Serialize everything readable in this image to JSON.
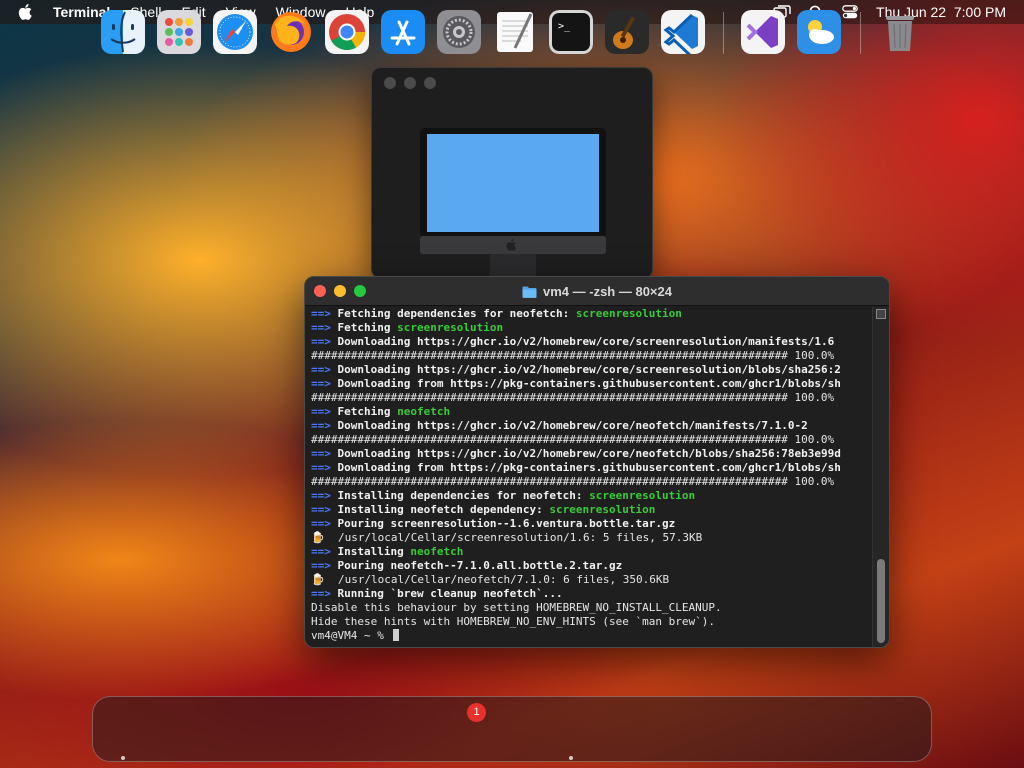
{
  "menubar": {
    "app_name": "Terminal",
    "menus": [
      "Shell",
      "Edit",
      "View",
      "Window",
      "Help"
    ],
    "clock": "Thu Jun 22  7:00 PM"
  },
  "terminal": {
    "title": "vm4 — -zsh — 80×24",
    "lines": [
      {
        "prefix": "==>",
        "parts": [
          {
            "t": " Fetching dependencies for neofetch: ",
            "s": "b"
          },
          {
            "t": "screenresolution",
            "s": "g"
          }
        ]
      },
      {
        "prefix": "==>",
        "parts": [
          {
            "t": " Fetching ",
            "s": "b"
          },
          {
            "t": "screenresolution",
            "s": "g"
          }
        ]
      },
      {
        "prefix": "==>",
        "parts": [
          {
            "t": " Downloading https://ghcr.io/v2/homebrew/core/screenresolution/manifests/1.6",
            "s": "b"
          }
        ]
      },
      {
        "prefix": "",
        "parts": [
          {
            "t": "######################################################################## 100.0%",
            "s": ""
          }
        ]
      },
      {
        "prefix": "==>",
        "parts": [
          {
            "t": " Downloading https://ghcr.io/v2/homebrew/core/screenresolution/blobs/sha256:2",
            "s": "b"
          }
        ]
      },
      {
        "prefix": "==>",
        "parts": [
          {
            "t": " Downloading from https://pkg-containers.githubusercontent.com/ghcr1/blobs/sh",
            "s": "b"
          }
        ]
      },
      {
        "prefix": "",
        "parts": [
          {
            "t": "######################################################################## 100.0%",
            "s": ""
          }
        ]
      },
      {
        "prefix": "==>",
        "parts": [
          {
            "t": " Fetching ",
            "s": "b"
          },
          {
            "t": "neofetch",
            "s": "g"
          }
        ]
      },
      {
        "prefix": "==>",
        "parts": [
          {
            "t": " Downloading https://ghcr.io/v2/homebrew/core/neofetch/manifests/7.1.0-2",
            "s": "b"
          }
        ]
      },
      {
        "prefix": "",
        "parts": [
          {
            "t": "######################################################################## 100.0%",
            "s": ""
          }
        ]
      },
      {
        "prefix": "==>",
        "parts": [
          {
            "t": " Downloading https://ghcr.io/v2/homebrew/core/neofetch/blobs/sha256:78eb3e99d",
            "s": "b"
          }
        ]
      },
      {
        "prefix": "==>",
        "parts": [
          {
            "t": " Downloading from https://pkg-containers.githubusercontent.com/ghcr1/blobs/sh",
            "s": "b"
          }
        ]
      },
      {
        "prefix": "",
        "parts": [
          {
            "t": "######################################################################## 100.0%",
            "s": ""
          }
        ]
      },
      {
        "prefix": "==>",
        "parts": [
          {
            "t": " Installing dependencies for neofetch: ",
            "s": "b"
          },
          {
            "t": "screenresolution",
            "s": "g"
          }
        ]
      },
      {
        "prefix": "==>",
        "parts": [
          {
            "t": " Installing neofetch dependency: ",
            "s": "b"
          },
          {
            "t": "screenresolution",
            "s": "g"
          }
        ]
      },
      {
        "prefix": "==>",
        "parts": [
          {
            "t": " Pouring screenresolution--1.6.ventura.bottle.tar.gz",
            "s": "b"
          }
        ]
      },
      {
        "prefix": "🍺",
        "parts": [
          {
            "t": "  /usr/local/Cellar/screenresolution/1.6: 5 files, 57.3KB",
            "s": ""
          }
        ]
      },
      {
        "prefix": "==>",
        "parts": [
          {
            "t": " Installing ",
            "s": "b"
          },
          {
            "t": "neofetch",
            "s": "g"
          }
        ]
      },
      {
        "prefix": "==>",
        "parts": [
          {
            "t": " Pouring neofetch--7.1.0.all.bottle.2.tar.gz",
            "s": "b"
          }
        ]
      },
      {
        "prefix": "🍺",
        "parts": [
          {
            "t": "  /usr/local/Cellar/neofetch/7.1.0: 6 files, 350.6KB",
            "s": ""
          }
        ]
      },
      {
        "prefix": "==>",
        "parts": [
          {
            "t": " Running `brew cleanup neofetch`...",
            "s": "b"
          }
        ]
      },
      {
        "prefix": "",
        "parts": [
          {
            "t": "Disable this behaviour by setting HOMEBREW_NO_INSTALL_CLEANUP.",
            "s": ""
          }
        ]
      },
      {
        "prefix": "",
        "parts": [
          {
            "t": "Hide these hints with HOMEBREW_NO_ENV_HINTS (see `man brew`).",
            "s": ""
          }
        ]
      }
    ],
    "prompt": "vm4@VM4 ~ % "
  },
  "dock": {
    "items": [
      "Finder",
      "Launchpad",
      "Safari",
      "Firefox",
      "Google Chrome",
      "App Store",
      "System Settings",
      "TextEdit",
      "Terminal",
      "GarageBand",
      "Visual Studio Code",
      "Visual Studio",
      "Weather",
      "Trash"
    ],
    "settings_badge": "1"
  },
  "colors": {
    "arrow": "#4a7bff",
    "highlight_green": "#3ac93a",
    "traffic_red": "#fe5f57",
    "traffic_yellow": "#febc2e",
    "traffic_green": "#28c840"
  }
}
